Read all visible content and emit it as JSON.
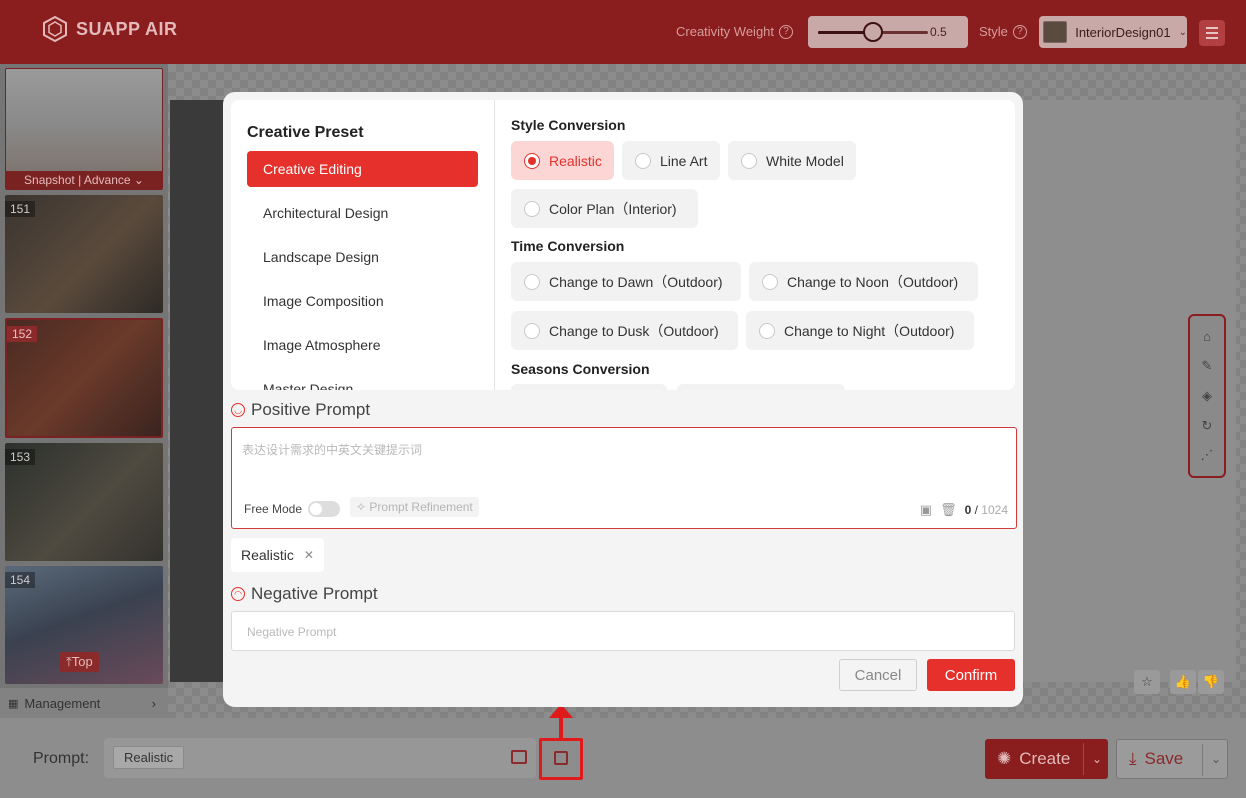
{
  "header": {
    "brand": "SUAPP AIR",
    "creativity_weight_label": "Creativity Weight",
    "creativity_weight_value": "0.5",
    "creativity_weight_fraction": 0.5,
    "style_label": "Style",
    "style_value": "InteriorDesign01"
  },
  "sidebar": {
    "snapshot_label": "Snapshot | Advance",
    "items": [
      {
        "num": "151"
      },
      {
        "num": "152"
      },
      {
        "num": "153"
      },
      {
        "num": "154"
      }
    ],
    "top_label": "Top",
    "management_label": "Management"
  },
  "bottom": {
    "prompt_label": "Prompt:",
    "prompt_tag": "Realistic",
    "create_label": "Create",
    "save_label": "Save"
  },
  "modal": {
    "preset_title": "Creative Preset",
    "presets": [
      "Creative Editing",
      "Architectural Design",
      "Landscape Design",
      "Image Composition",
      "Image Atmosphere",
      "Master Design"
    ],
    "style_conversion_title": "Style Conversion",
    "style_options": [
      "Realistic",
      "Line Art",
      "White Model",
      "Color Plan（Interior)"
    ],
    "time_conversion_title": "Time Conversion",
    "time_options": [
      "Change to Dawn（Outdoor)",
      "Change to Noon（Outdoor)",
      "Change to Dusk（Outdoor)",
      "Change to Night（Outdoor)"
    ],
    "seasons_conversion_title": "Seasons Conversion",
    "positive_prompt_label": "Positive Prompt",
    "positive_placeholder": "表达设计需求的中英文关键提示词",
    "free_mode_label": "Free Mode",
    "prompt_refinement_label": "Prompt Refinement",
    "char_count": "0",
    "char_sep": "/",
    "char_max": "1024",
    "selected_tag": "Realistic",
    "negative_prompt_label": "Negative Prompt",
    "negative_placeholder": "Negative Prompt",
    "cancel_label": "Cancel",
    "confirm_label": "Confirm"
  },
  "colors": {
    "accent": "#e5302b",
    "header_bg": "#8a1d1d"
  }
}
